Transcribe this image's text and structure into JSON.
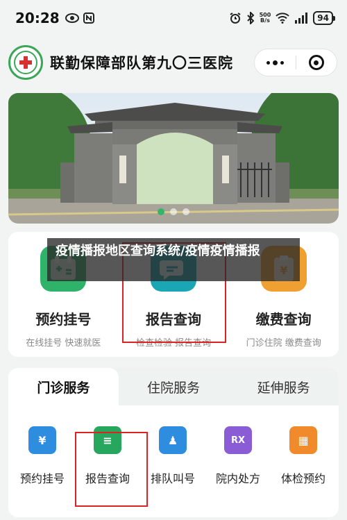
{
  "status_bar": {
    "time": "20:28",
    "net_speed_value": "500",
    "net_speed_unit": "B/s",
    "battery": "94"
  },
  "header": {
    "hospital_name": "联勤保障部队第九〇三医院"
  },
  "banner": {
    "slide_count": 3,
    "active_slide": 1
  },
  "quick_actions": [
    {
      "title": "预约挂号",
      "subtitle": "在线挂号 快速就医",
      "color": "#2fb36a"
    },
    {
      "title": "报告查询",
      "subtitle": "检查检验 报告查询",
      "color": "#1aa6b5"
    },
    {
      "title": "缴费查询",
      "subtitle": "门诊住院 缴费查询",
      "color": "#f0a030"
    }
  ],
  "watermark": {
    "text": "疫情播报地区查询系统/疫情疫情播报"
  },
  "service_tabs": [
    {
      "label": "门诊服务",
      "active": true
    },
    {
      "label": "住院服务",
      "active": false
    },
    {
      "label": "延伸服务",
      "active": false
    }
  ],
  "services": [
    {
      "label": "预约挂号",
      "icon": "yen-ticket-icon",
      "glyph": "¥",
      "color": "#2f8de0"
    },
    {
      "label": "报告查询",
      "icon": "report-document-icon",
      "glyph": "≡",
      "color": "#27a65d"
    },
    {
      "label": "排队叫号",
      "icon": "queue-person-icon",
      "glyph": "♟",
      "color": "#2f8de0"
    },
    {
      "label": "院内处方",
      "icon": "rx-prescription-icon",
      "glyph": "RX",
      "color": "#8a5cd6"
    },
    {
      "label": "体检预约",
      "icon": "checkup-calendar-icon",
      "glyph": "▦",
      "color": "#f08a2a"
    }
  ]
}
